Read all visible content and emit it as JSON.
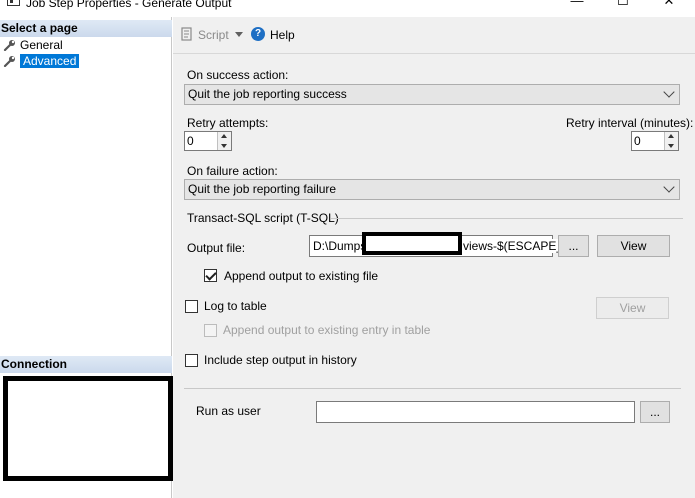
{
  "window": {
    "title": "Job Step Properties - Generate Output",
    "minimize_glyph": "—",
    "maximize_glyph": "☐",
    "close_glyph": "✕"
  },
  "left_pane": {
    "select_page_header": "Select a page",
    "pages": [
      {
        "label": "General",
        "icon": "wrench-icon",
        "selected": false
      },
      {
        "label": "Advanced",
        "icon": "wrench-icon",
        "selected": true
      }
    ],
    "connection_header": "Connection"
  },
  "toolbar": {
    "script_label": "Script",
    "help_label": "Help"
  },
  "form": {
    "on_success_label": "On success action:",
    "on_success_value": "Quit the job reporting success",
    "retry_attempts_label": "Retry attempts:",
    "retry_attempts_value": "0",
    "retry_interval_label": "Retry interval (minutes):",
    "retry_interval_value": "0",
    "on_failure_label": "On failure action:",
    "on_failure_value": "Quit the job reporting failure",
    "tsql_section_label": "Transact-SQL script (T-SQL)",
    "output_file_label": "Output file:",
    "output_file_prefix": "D:\\Dumps",
    "output_file_suffix": "views-$(ESCAPE_",
    "browse_label": "...",
    "view_label": "View",
    "append_output_label": "Append output to existing file",
    "append_output_checked": true,
    "log_to_table_label": "Log to table",
    "log_to_table_checked": false,
    "log_view_label": "View",
    "append_entry_label": "Append output to existing entry in table",
    "include_history_label": "Include step output in history",
    "include_history_checked": false,
    "run_as_user_label": "Run as user",
    "run_as_user_value": "",
    "run_as_browse_label": "..."
  },
  "colors": {
    "selection": "#0078d7",
    "header_gradient_top": "#dfe9f5",
    "panel_bg": "#f0f0f0"
  }
}
